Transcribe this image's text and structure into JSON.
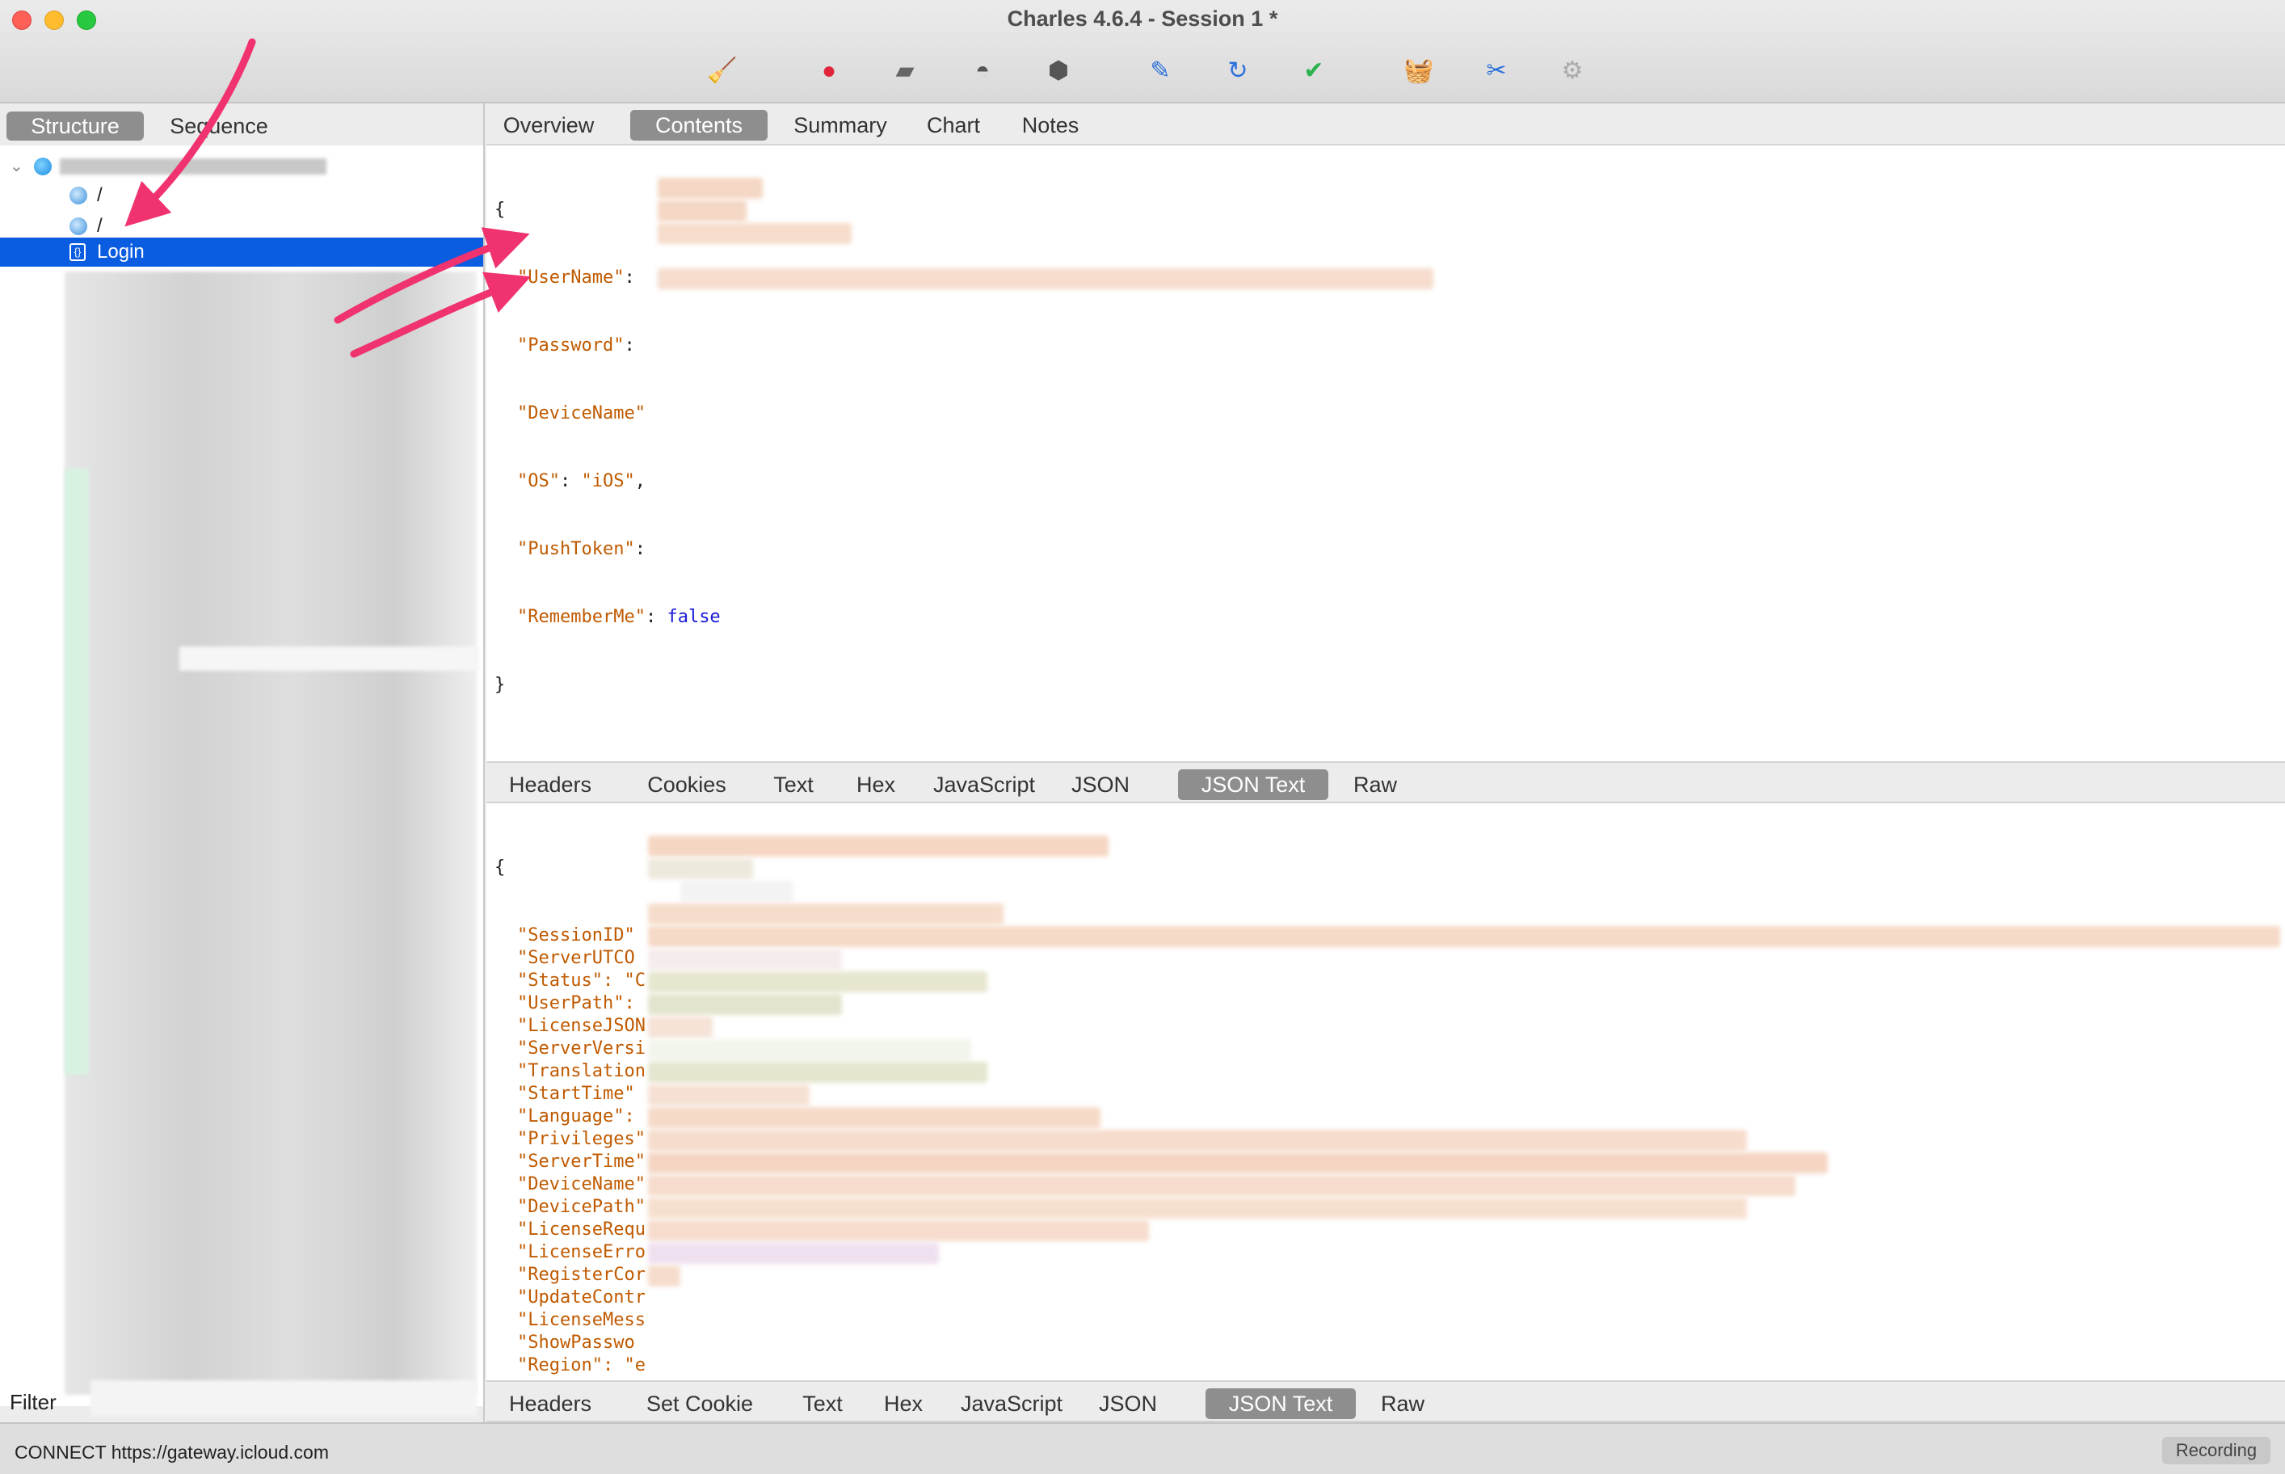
{
  "window": {
    "title": "Charles 4.6.4 - Session 1 *"
  },
  "toolbar": {
    "tools": [
      {
        "name": "broom-icon",
        "glyph": "🧹",
        "color": "#d4a017"
      },
      {
        "name": "record-icon",
        "glyph": "●",
        "color": "#e0243a"
      },
      {
        "name": "throttle-icon",
        "glyph": "▰",
        "color": "#666666"
      },
      {
        "name": "turtle-icon",
        "glyph": "◓",
        "color": "#555555"
      },
      {
        "name": "stop-icon",
        "glyph": "⬢",
        "color": "#555555"
      },
      {
        "name": "pen-icon",
        "glyph": "✎",
        "color": "#2a6fdb"
      },
      {
        "name": "refresh-icon",
        "glyph": "↻",
        "color": "#2a6fdb"
      },
      {
        "name": "check-icon",
        "glyph": "✔",
        "color": "#2bb24c"
      },
      {
        "name": "basket-icon",
        "glyph": "🧺",
        "color": "#2bb24c"
      },
      {
        "name": "tools-icon",
        "glyph": "✂",
        "color": "#2a6fdb"
      },
      {
        "name": "settings-gear-icon",
        "glyph": "⚙",
        "color": "#aaaaaa"
      }
    ]
  },
  "left": {
    "view_tabs": [
      "Structure",
      "Sequence"
    ],
    "active_view": "Structure",
    "tree": {
      "host_icon": "globe-icon",
      "items": [
        {
          "label": "/",
          "icon": "request-icon"
        },
        {
          "label": "/",
          "icon": "request-icon"
        },
        {
          "label": "Login",
          "icon": "json-file-icon",
          "selected": true
        }
      ]
    },
    "filter_label": "Filter"
  },
  "top_tabs": {
    "items": [
      "Overview",
      "Contents",
      "Summary",
      "Chart",
      "Notes"
    ],
    "active": "Contents"
  },
  "request_body": {
    "open": "{",
    "close": "}",
    "lines": [
      {
        "key": "\"UserName\"",
        "sep": ":",
        "value": ""
      },
      {
        "key": "\"Password\"",
        "sep": ":",
        "value": ""
      },
      {
        "key": "\"DeviceName\"",
        "sep": "",
        "value": ""
      },
      {
        "key": "\"OS\"",
        "sep": ": ",
        "value": "\"iOS\"",
        "trail": ","
      },
      {
        "key": "\"PushToken\"",
        "sep": ":",
        "value": ""
      },
      {
        "key": "\"RememberMe\"",
        "sep": ": ",
        "value": "false"
      }
    ]
  },
  "request_tabs": {
    "items": [
      "Headers",
      "Cookies",
      "Text",
      "Hex",
      "JavaScript",
      "JSON",
      "JSON Text",
      "Raw"
    ],
    "active": "JSON Text"
  },
  "response_body": {
    "open": "{",
    "close": "}",
    "keys": [
      "\"SessionID\"",
      "\"ServerUTCO",
      "\"Status\": \"C",
      "\"UserPath\":",
      "\"LicenseJSON",
      "\"ServerVersi",
      "\"Translation",
      "\"StartTime\"",
      "\"Language\":",
      "\"Privileges\"",
      "\"ServerTime\"",
      "\"DeviceName\"",
      "\"DevicePath\"",
      "\"LicenseRequ",
      "\"LicenseErro",
      "\"RegisterCor",
      "\"UpdateContr",
      "\"LicenseMess",
      "\"ShowPasswo",
      "\"Region\": \"e"
    ]
  },
  "response_tabs": {
    "items": [
      "Headers",
      "Set Cookie",
      "Text",
      "Hex",
      "JavaScript",
      "JSON",
      "JSON Text",
      "Raw"
    ],
    "active": "JSON Text"
  },
  "status": {
    "text": "CONNECT https://gateway.icloud.com",
    "recording_label": "Recording"
  },
  "colors": {
    "accent": "#0a5ce0",
    "json_key": "#c05a00",
    "json_keyword": "#1a1ad6",
    "annotation_arrow": "#f0336e"
  }
}
